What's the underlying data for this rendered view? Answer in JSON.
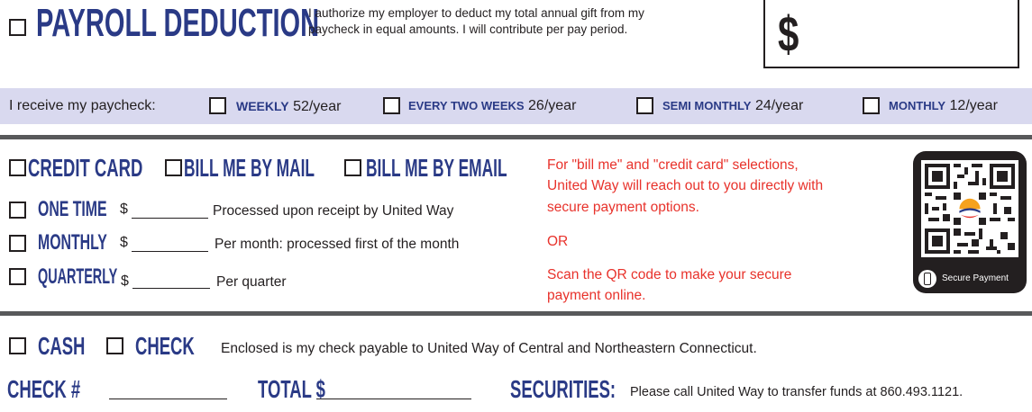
{
  "payroll": {
    "title": "PAYROLL DEDUCTION",
    "description_line1": "I authorize my employer to deduct my total annual gift from my",
    "description_line2": "paycheck in equal amounts. I will contribute per pay period.",
    "amount_symbol": "$"
  },
  "paycheck_frequency": {
    "label": "I receive my paycheck:",
    "options": [
      {
        "name": "WEEKLY",
        "rate": "52/year"
      },
      {
        "name": "EVERY TWO WEEKS",
        "rate": "26/year"
      },
      {
        "name": "SEMI MONTHLY",
        "rate": "24/year"
      },
      {
        "name": "MONTHLY",
        "rate": "12/year"
      }
    ]
  },
  "payment_methods": {
    "credit_card": "CREDIT CARD",
    "bill_mail": "BILL ME BY MAIL",
    "bill_email": "BILL ME BY EMAIL"
  },
  "schedules": [
    {
      "name": "ONE TIME",
      "currency": "$",
      "note": "Processed upon receipt by United Way"
    },
    {
      "name": "MONTHLY",
      "currency": "$",
      "note": "Per month: processed first of the month"
    },
    {
      "name": "QUARTERLY",
      "currency": "$",
      "note": "Per quarter"
    }
  ],
  "notice": {
    "line1": "For \"bill me\" and \"credit card\" selections,",
    "line2": "United Way will reach out to you directly with",
    "line3": "secure payment options.",
    "or": "OR",
    "line4": "Scan the QR code to make your secure",
    "line5": "payment online."
  },
  "qr": {
    "badge_label": "Secure Payment"
  },
  "cash_check": {
    "cash": "CASH",
    "check": "CHECK",
    "note": "Enclosed is my check payable to United Way of Central and Northeastern Connecticut."
  },
  "footer": {
    "check_number_label": "CHECK #",
    "total_label": "TOTAL $",
    "securities_label": "SECURITIES:",
    "securities_note": "Please call United Way to transfer funds at 860.493.1121."
  },
  "colors": {
    "navy": "#2a3a86",
    "red": "#e8322b",
    "band": "#d9d9ef",
    "rule": "#58595b"
  }
}
